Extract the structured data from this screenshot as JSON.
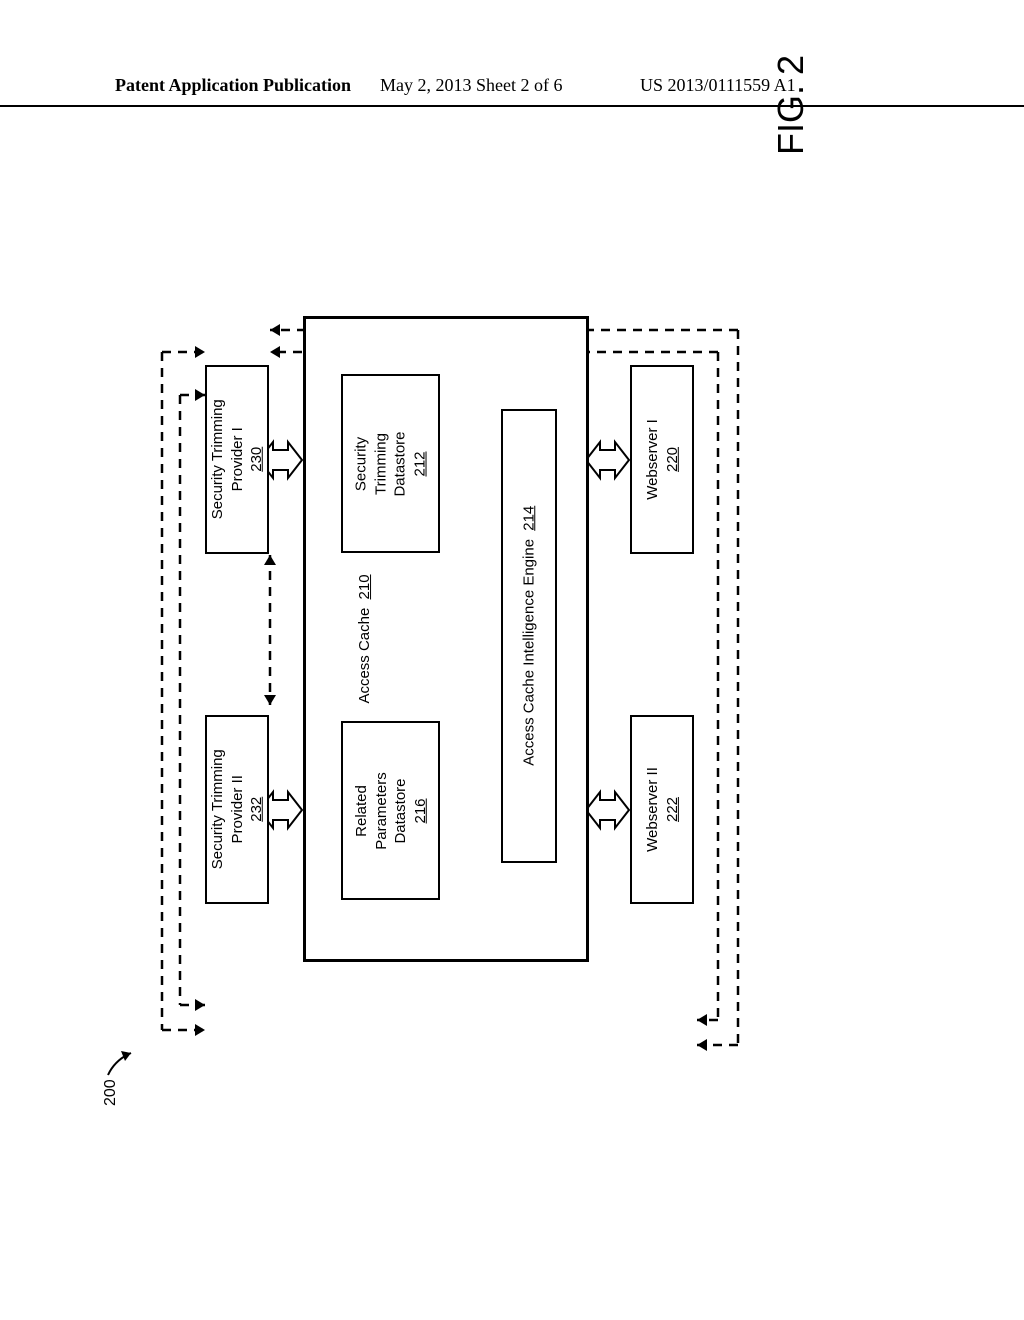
{
  "header": {
    "left": "Patent Application Publication",
    "center": "May 2, 2013  Sheet 2 of 6",
    "right": "US 2013/0111559 A1"
  },
  "figure_label": "FIG. 2",
  "ref_num": "200",
  "boxes": {
    "stp1": {
      "line1": "Security Trimming",
      "line2": "Provider I",
      "ref": "230"
    },
    "stp2": {
      "line1": "Security Trimming",
      "line2": "Provider II",
      "ref": "232"
    },
    "cache": {
      "label": "Access Cache",
      "ref": "210"
    },
    "std": {
      "line1": "Security",
      "line2": "Trimming",
      "line3": "Datastore",
      "ref": "212"
    },
    "rpd": {
      "line1": "Related",
      "line2": "Parameters",
      "line3": "Datastore",
      "ref": "216"
    },
    "engine": {
      "label": "Access Cache Intelligence Engine",
      "ref": "214"
    },
    "web1": {
      "label": "Webserver I",
      "ref": "220"
    },
    "web2": {
      "label": "Webserver II",
      "ref": "222"
    }
  }
}
